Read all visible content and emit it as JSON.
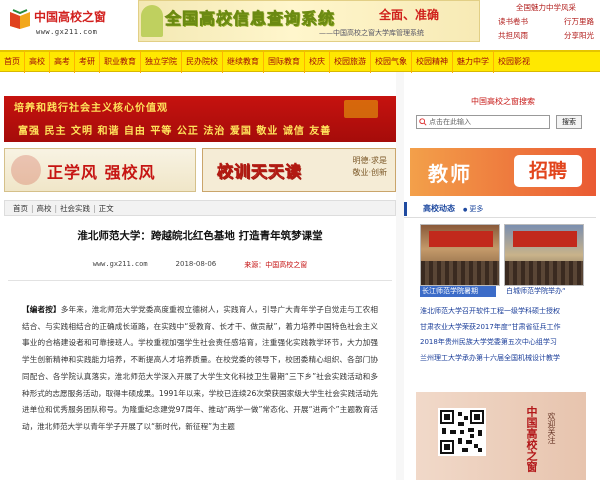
{
  "header": {
    "logo_text": "中国高校之窗",
    "logo_url": "www.gx211.com",
    "banner_main": "全国高校信息查询系统",
    "banner_right": "全面、准确",
    "banner_sub": "——中国高校之窗大学库管理系统",
    "side_links": [
      [
        "全国魅力中学风采"
      ],
      [
        "读书卷书",
        "行万里路"
      ],
      [
        "共担风雨",
        "分享阳光"
      ]
    ]
  },
  "nav": [
    "首页",
    "高校",
    "高考",
    "考研",
    "职业教育",
    "独立学院",
    "民办院校",
    "继续教育",
    "国际教育",
    "校庆",
    "校园旅游",
    "校园气象",
    "校园精神",
    "魅力中学",
    "校园影视"
  ],
  "banners": {
    "values_title": "培养和践行社会主义核心价值观",
    "values_words": "富强 民主 文明 和谐 自由 平等 公正 法治 爱国 敬业 诚信 友善",
    "promo_left": "正学风 强校风",
    "promo_right": "校训天天读",
    "promo_right_side1": "明德·求是",
    "promo_right_side2": "敬业·创新"
  },
  "breadcrumb": [
    "首页",
    "高校",
    "社会实践",
    "正文"
  ],
  "article": {
    "title": "淮北师范大学：跨越皖北红色基地  打造青年筑梦课堂",
    "site": "www.gx211.com",
    "date": "2018-08-06",
    "source": "来源：中国高校之窗",
    "lead": "【编者按】",
    "body": "多年来，淮北师范大学党委高度重视立德树人，实践育人，引导广大青年学子自觉走与工农相结合、与实践相结合的正确成长道路，在实践中“受教育、长才干、做贡献”，着力培养中国特色社会主义事业的合格建设者和可靠接班人。学校重视加强学生社会责任感培育，注重强化实践教学环节，大力加强学生创新精神和实践能力培养，不断提高人才培养质量。在校党委的领导下，校团委精心组织、各部门协同配合、各学院认真落实，淮北师范大学深入开展了大学生文化科技卫生暑期“三下乡”社会实践活动和多种形式的志愿服务活动，取得丰硕成果。1991年以来，学校已连续26次荣获国家级大学生社会实践活动先进单位和优秀服务团队称号。为隆重纪念建党97周年、推动“两学一做”常态化、开展“进两个”主题教育活动，淮北师范大学以青年学子开展了以“新时代，新征程”为主题"
  },
  "right": {
    "search_header": "中国高校之窗搜索",
    "search_placeholder": "点击在此输入",
    "search_button": "搜索",
    "recruit_left": "教师",
    "recruit_right": "招聘",
    "news_title": "高校动态",
    "news_more": "更多",
    "thumb_captions": [
      "长江师范学院暑期",
      "白城师范学院举办“"
    ],
    "news_items": [
      "淮北师范大学召开软件工程一级学科硕士授权",
      "甘肃农业大学荣获2017年度“甘肃省征兵工作",
      "2018年贵州民族大学党委第五次中心组学习",
      "兰州理工大学承办第十六届全国机械设计教学"
    ],
    "qr_label": "中国高校之窗",
    "qr_label2": "欢迎关注"
  }
}
